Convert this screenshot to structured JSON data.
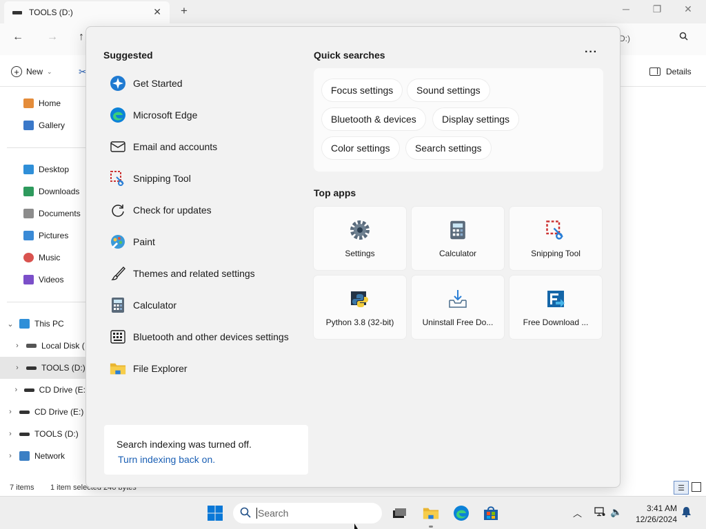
{
  "window": {
    "tab_title": "TOOLS (D:)",
    "tab_close": "✕",
    "new_tab": "+",
    "address_fragment": "D:)"
  },
  "window_controls": {
    "minimize": "─",
    "maximize": "❐",
    "close": "✕"
  },
  "nav": {
    "back": "←",
    "forward": "→",
    "up": "↑"
  },
  "commandbar": {
    "new_label": "New",
    "details_label": "Details"
  },
  "sidebar": {
    "items": [
      {
        "label": "Home",
        "icon": "home-icon"
      },
      {
        "label": "Gallery",
        "icon": "gallery-icon"
      },
      {
        "label": "Desktop",
        "icon": "desktop-icon"
      },
      {
        "label": "Downloads",
        "icon": "downloads-icon"
      },
      {
        "label": "Documents",
        "icon": "documents-icon"
      },
      {
        "label": "Pictures",
        "icon": "pictures-icon"
      },
      {
        "label": "Music",
        "icon": "music-icon"
      },
      {
        "label": "Videos",
        "icon": "videos-icon"
      },
      {
        "label": "This PC",
        "icon": "pc-icon"
      },
      {
        "label": "Local Disk (",
        "icon": "drive-icon"
      },
      {
        "label": "TOOLS (D:)",
        "icon": "drive-icon"
      },
      {
        "label": "CD Drive (E:",
        "icon": "cd-icon"
      },
      {
        "label": "CD Drive (E:)",
        "icon": "cd-icon"
      },
      {
        "label": "TOOLS (D:)",
        "icon": "drive-icon"
      },
      {
        "label": "Network",
        "icon": "network-icon"
      }
    ]
  },
  "statusbar": {
    "items": "7 items",
    "selected": "1 item selected  246 bytes"
  },
  "search_panel": {
    "suggested_title": "Suggested",
    "suggested": [
      {
        "label": "Get Started",
        "icon": "get-started-icon"
      },
      {
        "label": "Microsoft Edge",
        "icon": "edge-icon"
      },
      {
        "label": "Email and accounts",
        "icon": "mail-icon"
      },
      {
        "label": "Snipping Tool",
        "icon": "snipping-tool-icon"
      },
      {
        "label": "Check for updates",
        "icon": "refresh-icon"
      },
      {
        "label": "Paint",
        "icon": "paint-icon"
      },
      {
        "label": "Themes and related settings",
        "icon": "brush-icon"
      },
      {
        "label": "Calculator",
        "icon": "calculator-icon"
      },
      {
        "label": "Bluetooth and other devices settings",
        "icon": "keyboard-icon"
      },
      {
        "label": "File Explorer",
        "icon": "folder-icon"
      }
    ],
    "quick_searches_title": "Quick searches",
    "more": "···",
    "quick_searches": [
      "Focus settings",
      "Sound settings",
      "Bluetooth & devices",
      "Display settings",
      "Color settings",
      "Search settings"
    ],
    "top_apps_title": "Top apps",
    "top_apps": [
      {
        "label": "Settings",
        "icon": "settings-gear-icon"
      },
      {
        "label": "Calculator",
        "icon": "calculator-icon"
      },
      {
        "label": "Snipping Tool",
        "icon": "snipping-tool-icon"
      },
      {
        "label": "Python 3.8 (32-bit)",
        "icon": "python-icon"
      },
      {
        "label": "Uninstall Free Do...",
        "icon": "uninstall-icon"
      },
      {
        "label": "Free Download ...",
        "icon": "free-download-icon"
      }
    ],
    "index_message": "Search indexing was turned off.",
    "index_link": "Turn indexing back on."
  },
  "taskbar": {
    "search_placeholder": "Search",
    "time": "3:41 AM",
    "date": "12/26/2024"
  },
  "colors": {
    "accent_blue": "#1a5fb4",
    "windows_blue": "#0a78d7",
    "folder_yellow": "#f4c232",
    "panel_bg": "#f2f2f2"
  }
}
